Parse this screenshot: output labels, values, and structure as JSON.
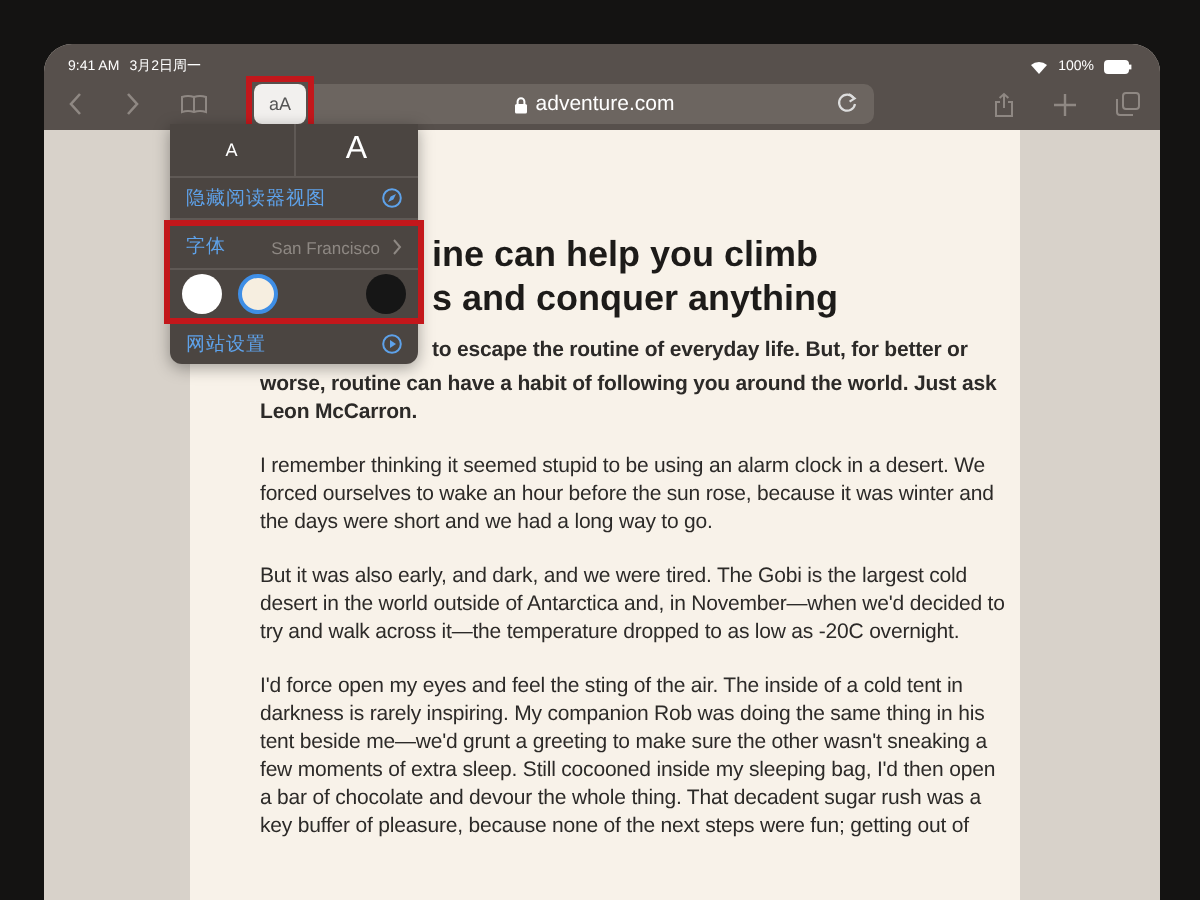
{
  "status_bar": {
    "time": "9:41 AM",
    "date": "3月2日周一",
    "battery": "100%"
  },
  "toolbar": {
    "reader_button": {
      "label": "aA",
      "highlighted": true
    },
    "address": "adventure.com"
  },
  "popover": {
    "font_sizes": [
      {
        "label": "A",
        "kind": "smaller"
      },
      {
        "label": "A",
        "kind": "larger"
      }
    ],
    "hide_reader": "隐藏阅读器视图",
    "appearance": {
      "highlighted": true,
      "font_label": "字体",
      "font_value": "San Francisco",
      "themes": [
        {
          "color": "#ffffff",
          "selected": false
        },
        {
          "color": "#f6eee0",
          "selected": true
        },
        {
          "color": "#161616",
          "selected": false
        }
      ]
    },
    "website_settings": "网站设置"
  },
  "article": {
    "title_lines": [
      "ine can help you climb",
      "s and conquer anything"
    ],
    "intro": [
      "to escape the routine of everyday life. But, for better or",
      "worse, routine can have a habit of following you around the world. Just ask Leon McCarron."
    ],
    "paragraphs": [
      "I remember thinking it seemed stupid to be using an alarm clock in a desert. We forced ourselves to wake an hour before the sun rose, because it was winter and the days were short and we had a long way to go.",
      "But it was also early, and dark, and we were tired. The Gobi is the largest cold desert in the world outside of Antarctica and, in November—when we'd decided to try and walk across it—the temperature dropped to as low as -20C overnight.",
      "I'd force open my eyes and feel the sting of the air. The inside of a cold tent in darkness is rarely inspiring. My companion Rob was doing the same thing in his tent beside me—we'd grunt a greeting to make sure the other wasn't sneaking a few moments of extra sleep. Still cocooned inside my sleeping bag, I'd then open a bar of chocolate and devour the whole thing. That decadent sugar rush was a key buffer of pleasure, because none of the next steps were fun; getting out of"
    ]
  }
}
